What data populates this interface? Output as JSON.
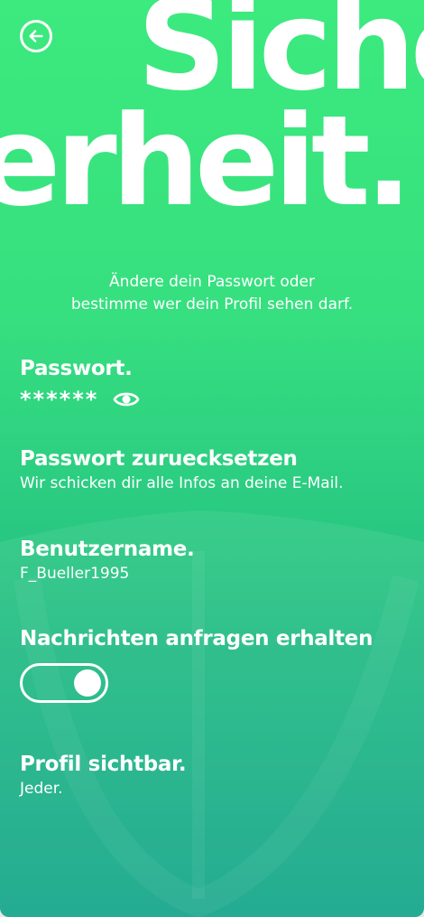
{
  "header": {
    "hero_line1": "Siche",
    "hero_line2": "erheit."
  },
  "intro": {
    "line1": "Ändere dein Passwort oder",
    "line2": "bestimme wer dein Profil sehen darf."
  },
  "password": {
    "title": "Passwort.",
    "masked_value": "******"
  },
  "reset": {
    "title": "Passwort zuruecksetzen",
    "subtitle": "Wir schicken dir alle Infos an deine E-Mail."
  },
  "username": {
    "title": "Benutzername.",
    "value": "F_Bueller1995"
  },
  "messages": {
    "title": "Nachrichten anfragen erhalten",
    "toggle_on": true
  },
  "visibility": {
    "title": "Profil sichtbar.",
    "value": "Jeder."
  },
  "icons": {
    "back": "arrow-left-circle-icon",
    "reveal": "eye-icon"
  },
  "colors": {
    "gradient_top": "#3cea7e",
    "gradient_bottom": "#14a58a",
    "text": "#ffffff"
  }
}
